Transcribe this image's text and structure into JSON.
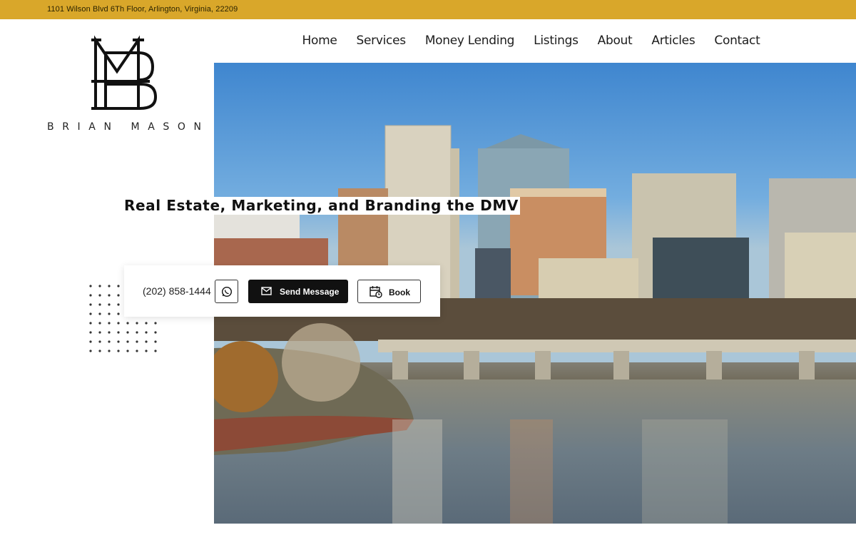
{
  "topbar": {
    "address": "1101 Wilson Blvd 6Th Floor, Arlington, Virginia, 22209",
    "color": "#d9a72a"
  },
  "logo": {
    "wordmark": "BRIAN MASON"
  },
  "nav": {
    "items": [
      {
        "label": "Home"
      },
      {
        "label": "Services"
      },
      {
        "label": "Money Lending"
      },
      {
        "label": "Listings"
      },
      {
        "label": "About"
      },
      {
        "label": "Articles"
      },
      {
        "label": "Contact"
      }
    ]
  },
  "hero": {
    "headline": "Real Estate, Marketing, and Branding the DMV"
  },
  "cta": {
    "phone": "(202) 858-1444",
    "whatsapp_icon": "whatsapp-icon",
    "send_label": "Send Message",
    "send_icon": "envelope-icon",
    "book_label": "Book",
    "book_icon": "calendar-clock-icon"
  }
}
